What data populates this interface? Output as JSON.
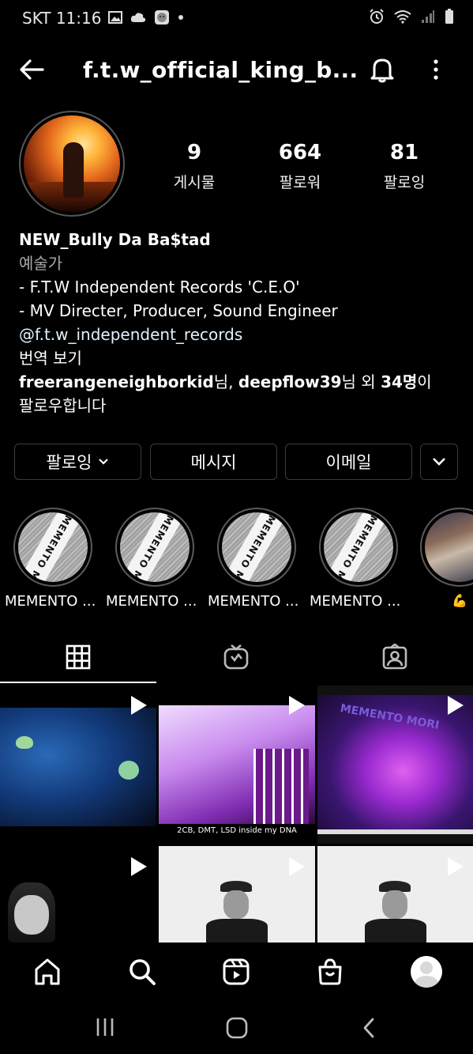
{
  "status": {
    "carrier_time": "SKT 11:16"
  },
  "header": {
    "username": "f.t.w_official_king_b..."
  },
  "profile": {
    "stats": [
      {
        "value": "9",
        "label": "게시물"
      },
      {
        "value": "664",
        "label": "팔로워"
      },
      {
        "value": "81",
        "label": "팔로잉"
      }
    ],
    "name": "NEW_Bully Da Ba$tad",
    "category": "예술가",
    "bio_lines": [
      "- F.T.W Independent Records 'C.E.O'",
      "- MV Directer, Producer, Sound Engineer",
      "@f.t.w_independent_records",
      "번역 보기"
    ],
    "followed_by": {
      "user1": "freerangeneighborkid",
      "sep1": "님, ",
      "user2": "deepflow39",
      "sep2": "님 외 ",
      "count": "34명",
      "end": "이",
      "line2": "팔로우합니다"
    }
  },
  "buttons": {
    "following": "팔로잉",
    "message": "메시지",
    "email": "이메일"
  },
  "highlights": [
    {
      "label": "MEMENTO ...",
      "band": "MEMENTO M"
    },
    {
      "label": "MEMENTO ...",
      "band": "MEMENTO M"
    },
    {
      "label": "MEMENTO ...",
      "band": "MEMENTO M"
    },
    {
      "label": "MEMENTO ...",
      "band": "MEMENTO M"
    },
    {
      "label": "💪"
    }
  ],
  "grid": {
    "captions": {
      "post2": "2CB, DMT, LSD inside my DNA",
      "post3": "MEMENTO MORI"
    }
  },
  "colors": {
    "background": "#000000",
    "link": "#e0f1ff",
    "secondary_text": "#a8a8a8",
    "button_border": "#3c3c3c"
  }
}
